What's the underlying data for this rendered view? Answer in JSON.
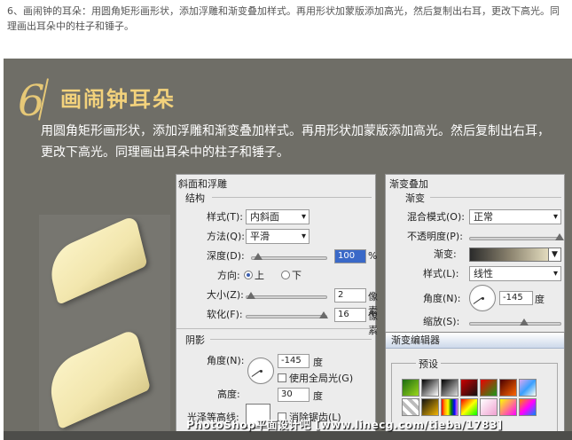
{
  "caption": "6、画闹钟的耳朵：用圆角矩形画形状，添加浮雕和渐变叠加样式。再用形状加蒙版添加高光，然后复制出右耳，更改下高光。同理画出耳朵中的柱子和锤子。",
  "step": {
    "number": "6",
    "title": "画闹钟耳朵",
    "description": "用圆角矩形画形状，添加浮雕和渐变叠加样式。再用形状加蒙版添加高光。然后复制出右耳，更改下高光。同理画出耳朵中的柱子和锤子。"
  },
  "bevel": {
    "title": "斜面和浮雕",
    "structure": "结构",
    "style_label": "样式(T):",
    "style_value": "内斜面",
    "method_label": "方法(Q):",
    "method_value": "平滑",
    "depth_label": "深度(D):",
    "depth_value": "100",
    "depth_unit": "%",
    "direction_label": "方向:",
    "dir_up": "上",
    "dir_down": "下",
    "size_label": "大小(Z):",
    "size_value": "2",
    "soften_label": "软化(F):",
    "soften_value": "16",
    "px_unit": "像素",
    "shading": "阴影",
    "angle_label": "角度(N):",
    "angle_value": "-145",
    "deg_unit": "度",
    "global_light": "使用全局光(G)",
    "altitude_label": "高度:",
    "altitude_value": "30",
    "gloss_label": "光泽等高线:",
    "antialias": "消除锯齿(L)"
  },
  "gradient_overlay": {
    "title": "渐变叠加",
    "section": "渐变",
    "blend_label": "混合模式(O):",
    "blend_value": "正常",
    "opacity_label": "不透明度(P):",
    "gradient_label": "渐变:",
    "style_label": "样式(L):",
    "style_value": "线性",
    "angle_label": "角度(N):",
    "angle_value": "-145",
    "deg_unit": "度",
    "scale_label": "缩放(S):"
  },
  "gradient_editor": {
    "title": "渐变编辑器",
    "presets_label": "预设"
  },
  "watermark": "PhotoShop平面设计吧 [www.linecg.com/tieba/1783]",
  "colors": {
    "canvas": "#6f6e67",
    "accent": "#f3d27c",
    "ear": "#f5e9b5"
  }
}
